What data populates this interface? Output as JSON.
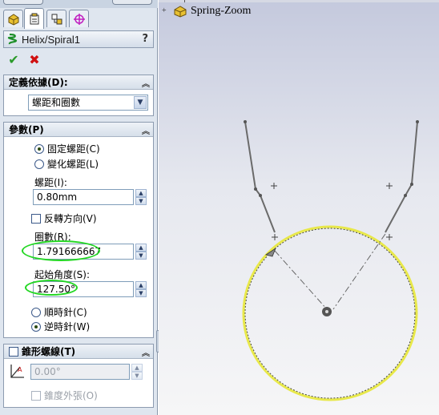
{
  "feature_manager": {
    "tabs": [
      "feature-manager-tab",
      "property-manager-tab",
      "configuration-manager-tab",
      "dim-xpert-tab"
    ],
    "title": "Helix/Spiral1",
    "help_label": "?"
  },
  "actions": {
    "ok": "✔",
    "cancel": "✖"
  },
  "definition": {
    "header": "定義依據(D):",
    "selected": "螺距和圈數"
  },
  "parameters": {
    "header": "參數(P)",
    "pitch_mode_constant": "固定螺距(C)",
    "pitch_mode_variable": "變化螺距(L)",
    "pitch_label": "螺距(I):",
    "pitch_value": "0.80mm",
    "reverse_label": "反轉方向(V)",
    "revolutions_label": "圈數(R):",
    "revolutions_value": "1.791666667",
    "start_angle_label": "起始角度(S):",
    "start_angle_value": "127.50°",
    "clockwise": "順時針(C)",
    "counterclockwise": "逆時針(W)"
  },
  "taper": {
    "header": "錐形螺線(T)",
    "angle_value": "0.00°",
    "outward_label": "錐度外張(O)"
  },
  "tree": {
    "root": "Spring-Zoom"
  },
  "colors": {
    "highlight_oval": "#24d724",
    "helix_path": "#e8e84a",
    "panel_bg": "#dfe6ef"
  }
}
